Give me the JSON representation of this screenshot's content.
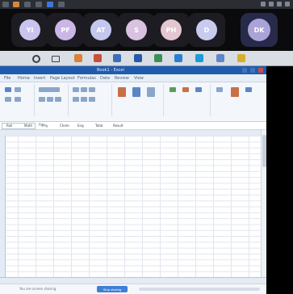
{
  "participants": [
    {
      "initials": "YI",
      "color": "#c9c4ee"
    },
    {
      "initials": "PF",
      "color": "#cbb6e6"
    },
    {
      "initials": "AT",
      "color": "#c3c7ee"
    },
    {
      "initials": "S",
      "color": "#d8c2df"
    },
    {
      "initials": "PH",
      "color": "#e3c6cf"
    },
    {
      "initials": "D",
      "color": "#c8cbef"
    },
    {
      "initials": "DK",
      "color": "#aaa3d8"
    }
  ],
  "excel": {
    "title": "Book1 - Excel",
    "tabs": [
      "File",
      "Home",
      "Insert",
      "Page Layout",
      "Formulas",
      "Data",
      "Review",
      "View"
    ],
    "headers": [
      "Roll",
      "Math",
      "Phy",
      "Chem",
      "Eng",
      "Total",
      "Result"
    ]
  },
  "share": {
    "status_text": "You are screen sharing",
    "stop_label": "Stop sharing"
  },
  "colors": {
    "accent": "#3f7fd8",
    "titlebar": "#1f5cad",
    "sidebar_bg": "#0b0b0d"
  }
}
